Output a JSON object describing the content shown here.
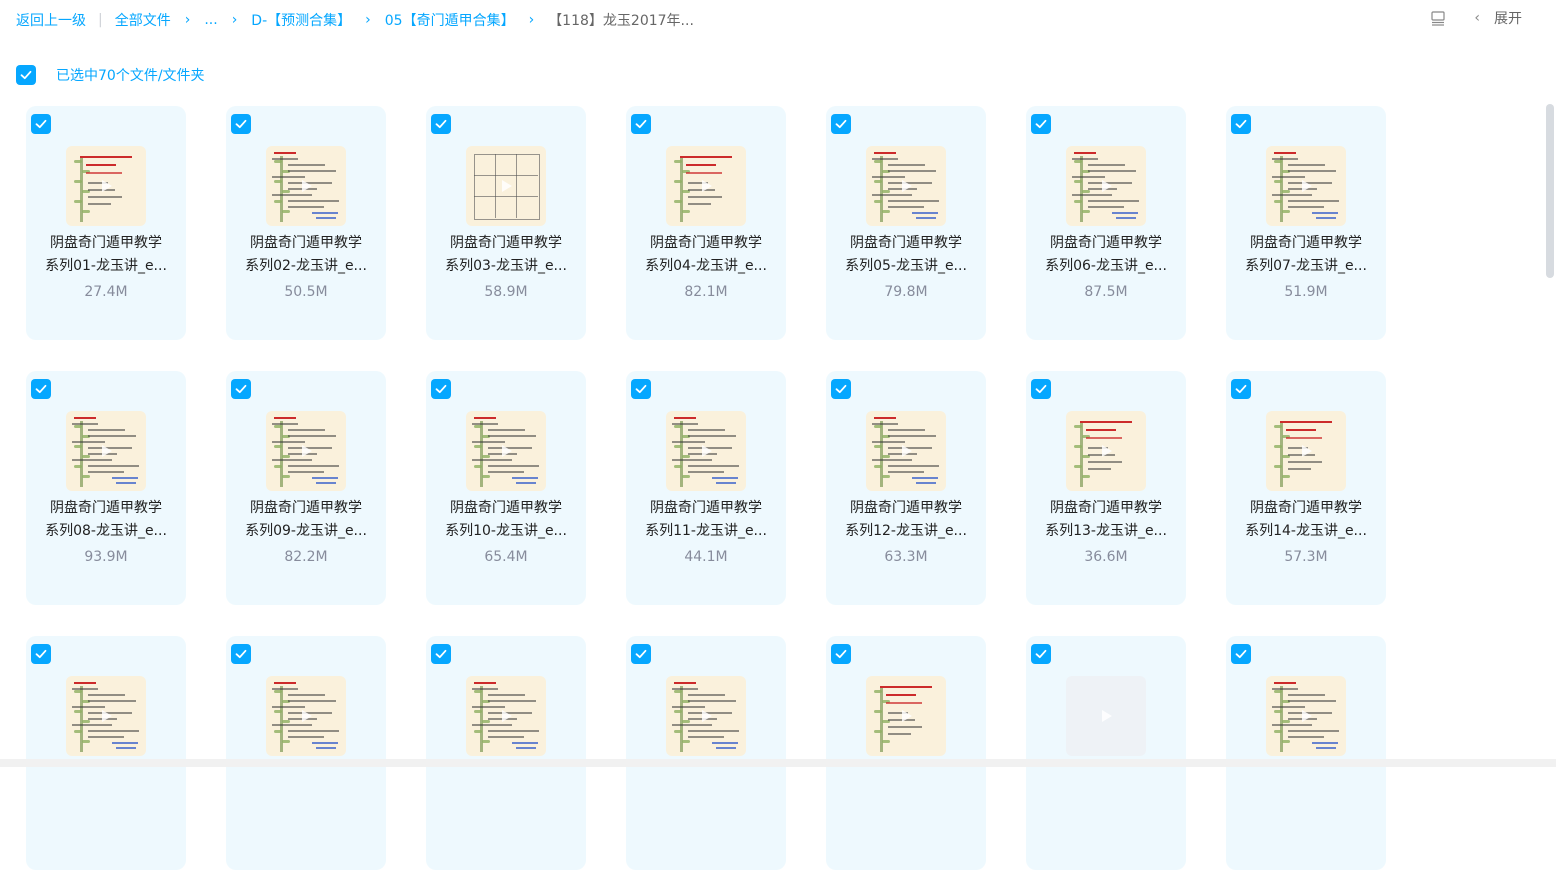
{
  "breadcrumb": {
    "back": "返回上一级",
    "all_files": "全部文件",
    "ellipsis": "...",
    "folder1": "D-【预测合集】",
    "folder2": "05【奇门遁甲合集】",
    "current": "【118】龙玉2017年..."
  },
  "toolbar": {
    "list_icon": "list-view-icon",
    "expand_label": "展开"
  },
  "selection": {
    "text": "已选中70个文件/文件夹"
  },
  "colors": {
    "accent": "#06a7ff",
    "card_bg": "#eef9fe"
  },
  "files": [
    {
      "name1": "阴盘奇门遁甲教学",
      "name2": "系列01-龙玉讲_e...",
      "size": "27.4M",
      "thumb": "slide"
    },
    {
      "name1": "阴盘奇门遁甲教学",
      "name2": "系列02-龙玉讲_e...",
      "size": "50.5M",
      "thumb": "text"
    },
    {
      "name1": "阴盘奇门遁甲教学",
      "name2": "系列03-龙玉讲_e...",
      "size": "58.9M",
      "thumb": "grid"
    },
    {
      "name1": "阴盘奇门遁甲教学",
      "name2": "系列04-龙玉讲_e...",
      "size": "82.1M",
      "thumb": "slide"
    },
    {
      "name1": "阴盘奇门遁甲教学",
      "name2": "系列05-龙玉讲_e...",
      "size": "79.8M",
      "thumb": "text"
    },
    {
      "name1": "阴盘奇门遁甲教学",
      "name2": "系列06-龙玉讲_e...",
      "size": "87.5M",
      "thumb": "text"
    },
    {
      "name1": "阴盘奇门遁甲教学",
      "name2": "系列07-龙玉讲_e...",
      "size": "51.9M",
      "thumb": "text"
    },
    {
      "name1": "阴盘奇门遁甲教学",
      "name2": "系列08-龙玉讲_e...",
      "size": "93.9M",
      "thumb": "text"
    },
    {
      "name1": "阴盘奇门遁甲教学",
      "name2": "系列09-龙玉讲_e...",
      "size": "82.2M",
      "thumb": "text"
    },
    {
      "name1": "阴盘奇门遁甲教学",
      "name2": "系列10-龙玉讲_e...",
      "size": "65.4M",
      "thumb": "text"
    },
    {
      "name1": "阴盘奇门遁甲教学",
      "name2": "系列11-龙玉讲_e...",
      "size": "44.1M",
      "thumb": "text"
    },
    {
      "name1": "阴盘奇门遁甲教学",
      "name2": "系列12-龙玉讲_e...",
      "size": "63.3M",
      "thumb": "text"
    },
    {
      "name1": "阴盘奇门遁甲教学",
      "name2": "系列13-龙玉讲_e...",
      "size": "36.6M",
      "thumb": "slide"
    },
    {
      "name1": "阴盘奇门遁甲教学",
      "name2": "系列14-龙玉讲_e...",
      "size": "57.3M",
      "thumb": "slide"
    },
    {
      "name1": "",
      "name2": "",
      "size": "",
      "thumb": "text"
    },
    {
      "name1": "",
      "name2": "",
      "size": "",
      "thumb": "text"
    },
    {
      "name1": "",
      "name2": "",
      "size": "",
      "thumb": "text"
    },
    {
      "name1": "",
      "name2": "",
      "size": "",
      "thumb": "text"
    },
    {
      "name1": "",
      "name2": "",
      "size": "",
      "thumb": "slide"
    },
    {
      "name1": "",
      "name2": "",
      "size": "",
      "thumb": "blank"
    },
    {
      "name1": "",
      "name2": "",
      "size": "",
      "thumb": "text"
    }
  ]
}
